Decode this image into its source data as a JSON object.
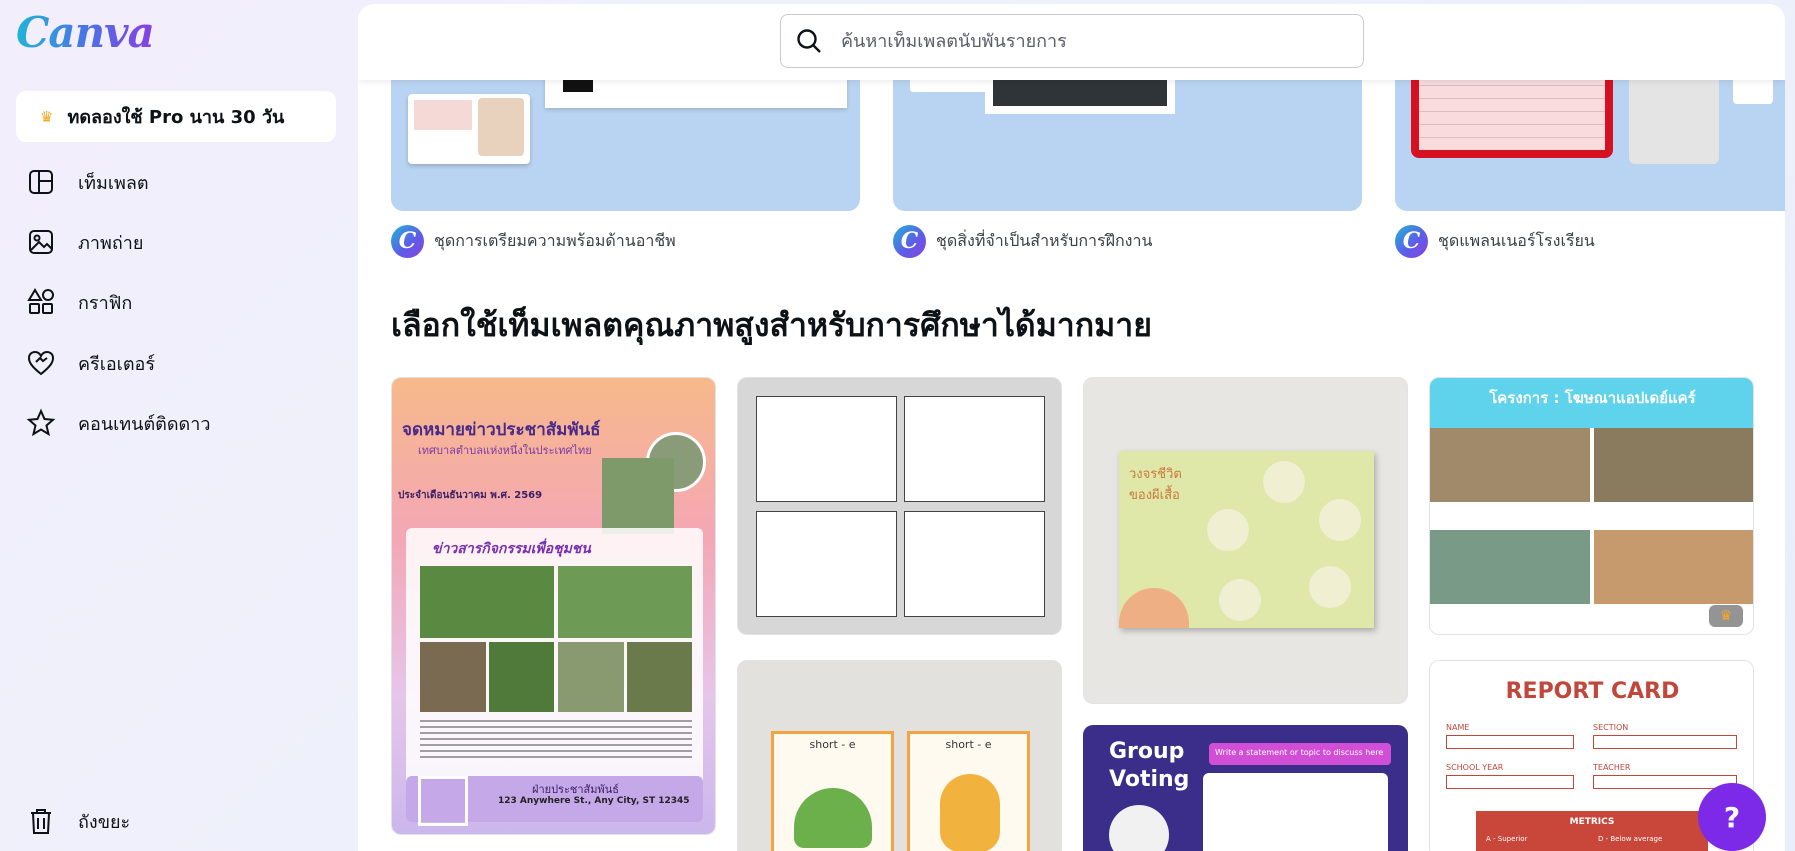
{
  "brand": {
    "logo_text": "Canva"
  },
  "sidebar": {
    "trial_label": "ทดลองใช้ Pro นาน 30 วัน",
    "items": [
      {
        "label": "เท็มเพลต",
        "icon": "template-icon"
      },
      {
        "label": "ภาพถ่าย",
        "icon": "photo-icon"
      },
      {
        "label": "กราฟิก",
        "icon": "graphics-icon"
      },
      {
        "label": "ครีเอเตอร์",
        "icon": "creator-heart-icon"
      },
      {
        "label": "คอนเทนต์ติดดาว",
        "icon": "star-icon"
      }
    ],
    "trash_label": "ถังขยะ"
  },
  "search": {
    "placeholder": "ค้นหาเท็มเพลตนับพันรายการ"
  },
  "sets": [
    {
      "caption": "ชุดการเตรียมความพร้อมด้านอาชีพ"
    },
    {
      "caption": "ชุดสิ่งที่จำเป็นสำหรับการฝึกงาน"
    },
    {
      "caption": "ชุดแพลนเนอร์โรงเรียน"
    }
  ],
  "section": {
    "title": "เลือกใช้เท็มเพลตคุณภาพสูงสำหรับการศึกษาได้มากมาย"
  },
  "templates": {
    "newsletter": {
      "title": "จดหมายข่าวประชาสัมพันธ์",
      "subtitle": "เทศบาลตำบลแห่งหนึ่งในประเทศไทย",
      "date": "ประจำเดือนธันวาคม พ.ศ. 2569",
      "heading": "ข่าวสารกิจกรรมเพื่อชุมชน",
      "footer_title": "ฝ่ายประชาสัมพันธ์",
      "address": "123 Anywhere St., Any City, ST 12345"
    },
    "life_cycle": {
      "title": "วงจรชีวิต ของผีเสื้อ"
    },
    "project": {
      "title": "โครงการ : โฆษณาแอปเดย์แคร์"
    },
    "phonics": {
      "left": "short - e",
      "right": "short - e"
    },
    "report": {
      "title": "REPORT CARD",
      "name": "NAME",
      "section": "SECTION",
      "school_year": "SCHOOL YEAR",
      "teacher": "TEACHER",
      "metrics": "METRICS",
      "grade_a": "A - Superior",
      "grade_d": "D - Below average"
    },
    "voting": {
      "title_line1": "Group",
      "title_line2": "Voting",
      "prompt": "Write a statement or topic to discuss here"
    }
  },
  "help": {
    "label": "?"
  },
  "colors": {
    "accent": "#7d2ae8",
    "card_blue": "#b9d3f2"
  }
}
